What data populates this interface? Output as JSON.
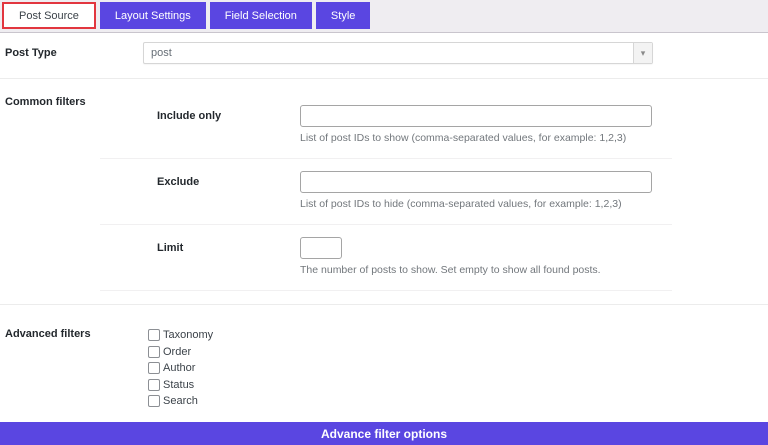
{
  "tabs": [
    {
      "label": "Post Source",
      "active": true
    },
    {
      "label": "Layout Settings",
      "active": false
    },
    {
      "label": "Field Selection",
      "active": false
    },
    {
      "label": "Style",
      "active": false
    }
  ],
  "post_type": {
    "label": "Post Type",
    "value": "post",
    "arrow_icon": "▾"
  },
  "common_filters": {
    "label": "Common filters",
    "fields": [
      {
        "label": "Include only",
        "value": "",
        "help": "List of post IDs to show (comma-separated values, for example: 1,2,3)"
      },
      {
        "label": "Exclude",
        "value": "",
        "help": "List of post IDs to hide (comma-separated values, for example: 1,2,3)"
      },
      {
        "label": "Limit",
        "value": "",
        "help": "The number of posts to show. Set empty to show all found posts."
      }
    ]
  },
  "advanced_filters": {
    "label": "Advanced filters",
    "options": [
      {
        "label": "Taxonomy",
        "checked": false
      },
      {
        "label": "Order",
        "checked": false
      },
      {
        "label": "Author",
        "checked": false
      },
      {
        "label": "Status",
        "checked": false
      },
      {
        "label": "Search",
        "checked": false
      }
    ]
  },
  "footer": {
    "button_label": "Advance filter options"
  },
  "colors": {
    "accent": "#5a46e1",
    "active_tab_border": "#e2363f"
  }
}
